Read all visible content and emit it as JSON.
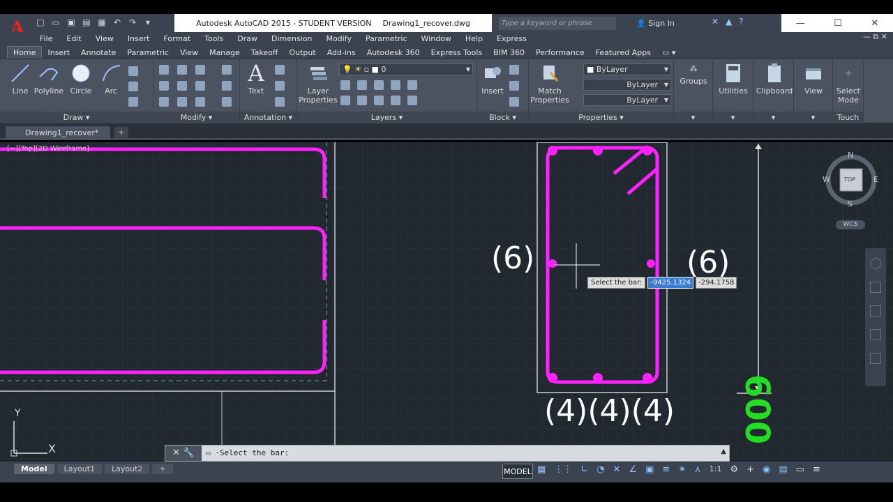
{
  "app": {
    "title": "Autodesk AutoCAD 2015 - STUDENT VERSION",
    "filename": "Drawing1_recover.dwg",
    "search_placeholder": "Type a keyword or phrase",
    "signin": "Sign In",
    "logo": "A"
  },
  "menu": [
    "File",
    "Edit",
    "View",
    "Insert",
    "Format",
    "Tools",
    "Draw",
    "Dimension",
    "Modify",
    "Parametric",
    "Window",
    "Help",
    "Express"
  ],
  "ribbon_tabs": [
    "Home",
    "Insert",
    "Annotate",
    "Parametric",
    "View",
    "Manage",
    "Takeoff",
    "Output",
    "Add-ins",
    "Autodesk 360",
    "Express Tools",
    "BIM 360",
    "Performance",
    "Featured Apps"
  ],
  "ribbon": {
    "draw": {
      "line": "Line",
      "polyline": "Polyline",
      "circle": "Circle",
      "arc": "Arc",
      "panel": "Draw ▾"
    },
    "modify": {
      "panel": "Modify ▾"
    },
    "annotation": {
      "text": "Text",
      "panel": "Annotation ▾"
    },
    "layers": {
      "layer_properties": "Layer Properties",
      "current_layer": "0",
      "panel": "Layers ▾"
    },
    "block": {
      "insert": "Insert",
      "panel": "Block ▾"
    },
    "properties": {
      "match": "Match Properties",
      "color": "ByLayer",
      "linetype": "ByLayer",
      "lineweight": "ByLayer",
      "panel": "Properties ▾"
    },
    "groups": "Groups",
    "utilities": "Utilities",
    "clipboard": "Clipboard",
    "view": "View",
    "select_mode": "Select Mode",
    "touch": "Touch"
  },
  "file_tab": "Drawing1_recover*",
  "viewport_label": "[−][Top][2D Wireframe]",
  "drawing": {
    "labels_side": [
      "(6)",
      "(6)"
    ],
    "labels_bottom": "(4)(4)(4)",
    "dimension": "600",
    "tooltip_label": "Select the bar:",
    "coord_x": "-9425.1324",
    "coord_y": "-294.1758"
  },
  "viewcube": {
    "n": "N",
    "s": "S",
    "e": "E",
    "w": "W",
    "top": "TOP",
    "wcs": "WCS"
  },
  "ucs": {
    "x": "X",
    "y": "Y"
  },
  "command_line": "Select the bar:",
  "layout_tabs": [
    "Model",
    "Layout1",
    "Layout2"
  ],
  "status": {
    "model": "MODEL",
    "scale": "1:1"
  },
  "colors": {
    "rebar": "#ff22ff",
    "dimension": "#22dd22",
    "canvas": "#212830"
  }
}
